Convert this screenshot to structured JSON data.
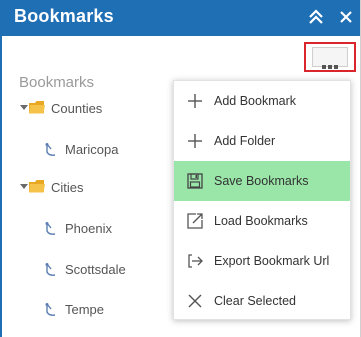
{
  "window": {
    "title": "Bookmarks"
  },
  "tree": {
    "header": "Bookmarks",
    "folders": [
      {
        "label": "Counties",
        "items": [
          "Maricopa"
        ]
      },
      {
        "label": "Cities",
        "items": [
          "Phoenix",
          "Scottsdale",
          "Tempe"
        ]
      }
    ]
  },
  "menu": {
    "items": [
      {
        "label": "Add Bookmark",
        "icon": "plus-icon"
      },
      {
        "label": "Add Folder",
        "icon": "plus-icon"
      },
      {
        "label": "Save Bookmarks",
        "icon": "floppy-disk-icon",
        "active": true
      },
      {
        "label": "Load Bookmarks",
        "icon": "load-edit-icon"
      },
      {
        "label": "Export Bookmark Url",
        "icon": "export-icon"
      },
      {
        "label": "Clear Selected",
        "icon": "close-x-icon"
      }
    ]
  },
  "colors": {
    "title_bar": "#1f6fb5",
    "highlight": "#99e6a8",
    "menu_button_border": "#d9262c",
    "folder": "#f2b634"
  }
}
